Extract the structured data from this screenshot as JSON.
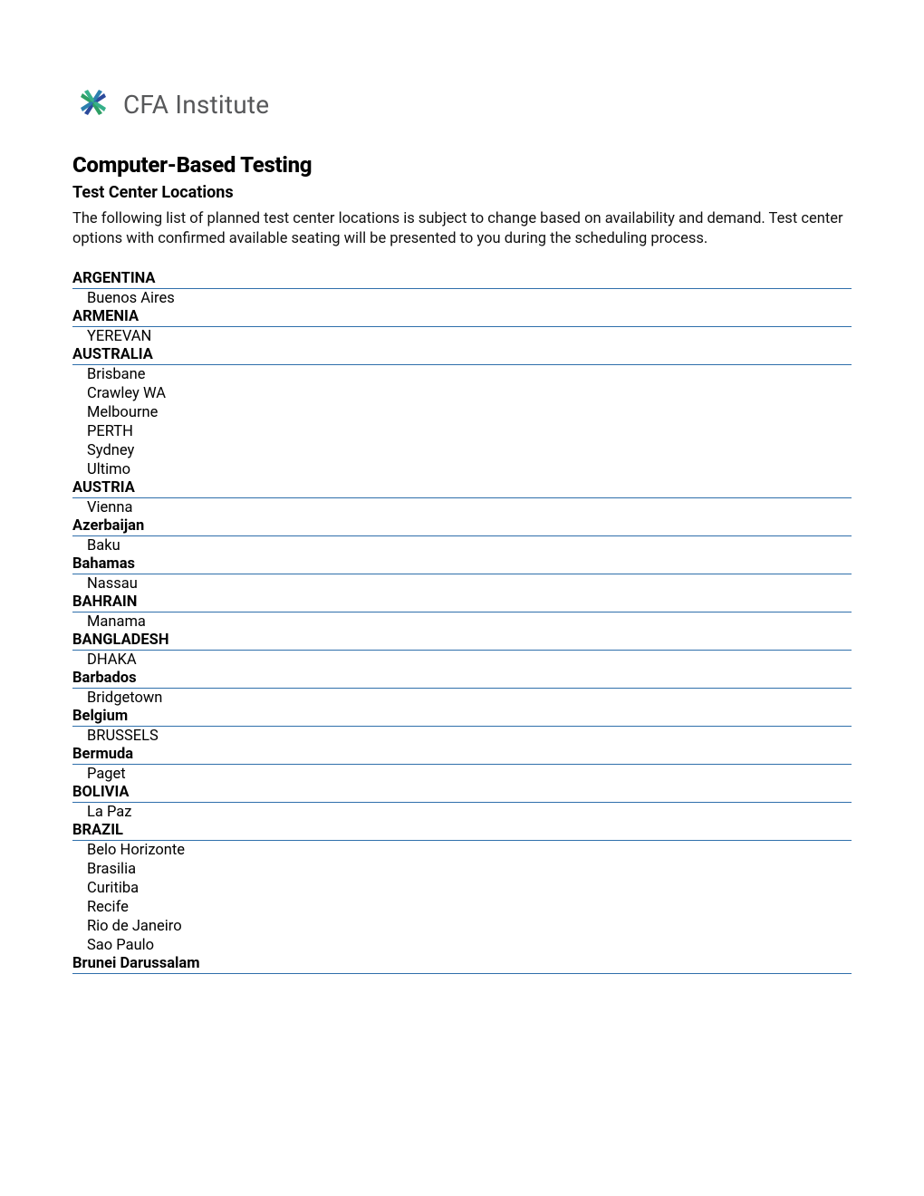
{
  "logo": {
    "text": "CFA Institute"
  },
  "heading": {
    "main": "Computer-Based Testing",
    "sub": "Test Center Locations"
  },
  "intro": "The following list of planned test center locations is subject to change based on availability and demand. Test center options with confirmed available seating will be presented to you during the scheduling process.",
  "countries": [
    {
      "name": "ARGENTINA",
      "cities": [
        "Buenos Aires"
      ]
    },
    {
      "name": "ARMENIA",
      "cities": [
        "YEREVAN"
      ]
    },
    {
      "name": "AUSTRALIA",
      "cities": [
        "Brisbane",
        "Crawley WA",
        "Melbourne",
        "PERTH",
        "Sydney",
        "Ultimo"
      ]
    },
    {
      "name": "AUSTRIA",
      "cities": [
        "Vienna"
      ]
    },
    {
      "name": "Azerbaijan",
      "cities": [
        "Baku"
      ]
    },
    {
      "name": "Bahamas",
      "cities": [
        "Nassau"
      ]
    },
    {
      "name": "BAHRAIN",
      "cities": [
        "Manama"
      ]
    },
    {
      "name": "BANGLADESH",
      "cities": [
        "DHAKA"
      ]
    },
    {
      "name": "Barbados",
      "cities": [
        "Bridgetown"
      ]
    },
    {
      "name": "Belgium",
      "cities": [
        "BRUSSELS"
      ]
    },
    {
      "name": "Bermuda",
      "cities": [
        "Paget"
      ]
    },
    {
      "name": "BOLIVIA",
      "cities": [
        "La Paz"
      ]
    },
    {
      "name": "BRAZIL",
      "cities": [
        "Belo Horizonte",
        "Brasilia",
        "Curitiba",
        "Recife",
        "Rio de Janeiro",
        "Sao Paulo"
      ]
    },
    {
      "name": "Brunei Darussalam",
      "cities": []
    }
  ]
}
